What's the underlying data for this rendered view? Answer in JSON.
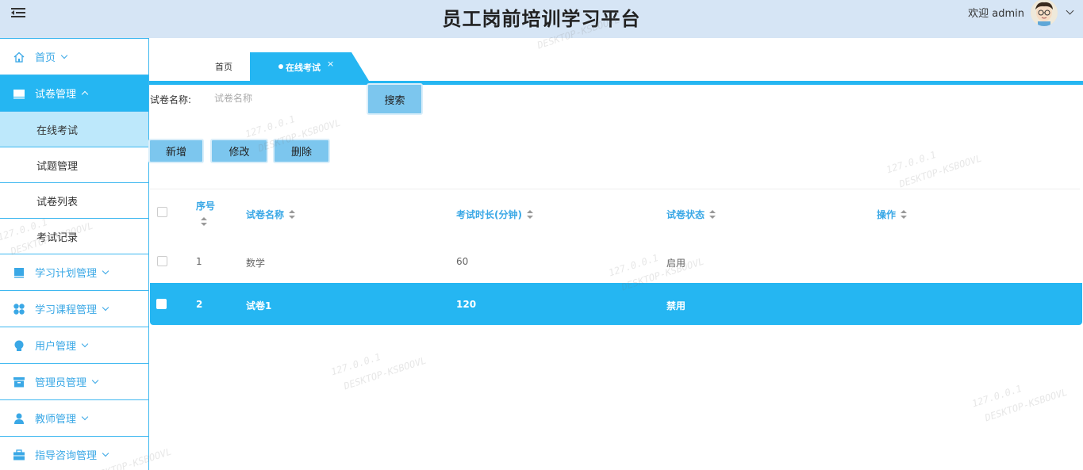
{
  "header": {
    "title": "员工岗前培训学习平台",
    "welcome": "欢迎 admin"
  },
  "sidebar": {
    "items": [
      {
        "label": "首页",
        "icon": "home-icon"
      },
      {
        "label": "试卷管理",
        "icon": "monitor-icon",
        "expanded": true
      },
      {
        "label": "学习计划管理",
        "icon": "book-icon"
      },
      {
        "label": "学习课程管理",
        "icon": "grid-icon"
      },
      {
        "label": "用户管理",
        "icon": "user-badge-icon"
      },
      {
        "label": "管理员管理",
        "icon": "archive-icon"
      },
      {
        "label": "教师管理",
        "icon": "person-icon"
      },
      {
        "label": "指导咨询管理",
        "icon": "briefcase-icon"
      }
    ],
    "subitems": [
      {
        "label": "在线考试"
      },
      {
        "label": "试题管理"
      },
      {
        "label": "试卷列表"
      },
      {
        "label": "考试记录"
      }
    ]
  },
  "tabs": {
    "home": "首页",
    "active": "在线考试",
    "close": "×"
  },
  "search": {
    "label": "试卷名称:",
    "placeholder": "试卷名称",
    "button": "搜索"
  },
  "toolbar": {
    "add": "新增",
    "edit": "修改",
    "delete": "删除"
  },
  "table": {
    "columns": [
      "序号",
      "试卷名称",
      "考试时长(分钟)",
      "试卷状态",
      "操作"
    ],
    "rows": [
      {
        "index": "1",
        "name": "数学",
        "duration": "60",
        "status": "启用",
        "action": ""
      },
      {
        "index": "2",
        "name": "试卷1",
        "duration": "120",
        "status": "禁用",
        "action": ""
      }
    ]
  },
  "watermark": {
    "ip": "127.0.0.1",
    "host": "DESKTOP-KSBOOVL"
  },
  "colors": {
    "accent": "#25b6f2",
    "header_bg": "#d6e5f5",
    "button_bg": "#7cc6ee"
  }
}
